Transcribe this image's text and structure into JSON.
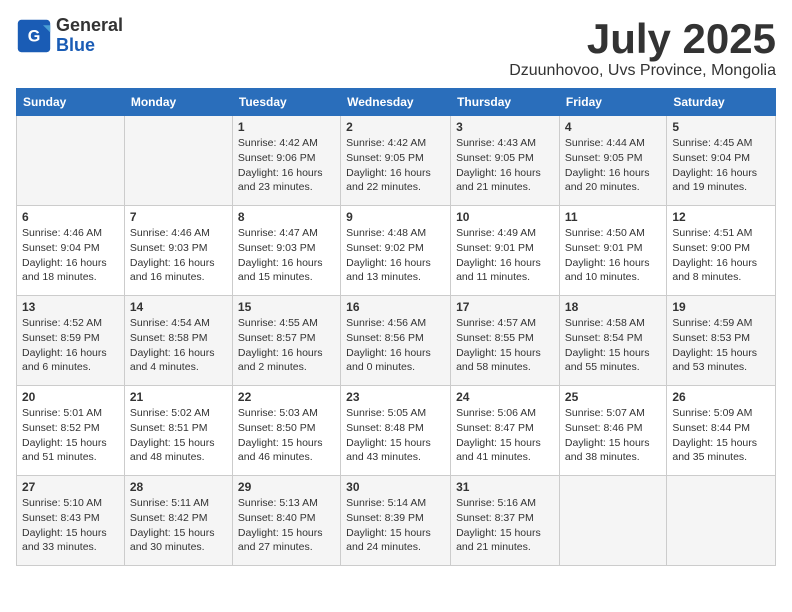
{
  "logo": {
    "general": "General",
    "blue": "Blue"
  },
  "title": "July 2025",
  "location": "Dzuunhovoo, Uvs Province, Mongolia",
  "days_of_week": [
    "Sunday",
    "Monday",
    "Tuesday",
    "Wednesday",
    "Thursday",
    "Friday",
    "Saturday"
  ],
  "weeks": [
    [
      {
        "day": "",
        "info": ""
      },
      {
        "day": "",
        "info": ""
      },
      {
        "day": "1",
        "info": "Sunrise: 4:42 AM\nSunset: 9:06 PM\nDaylight: 16 hours\nand 23 minutes."
      },
      {
        "day": "2",
        "info": "Sunrise: 4:42 AM\nSunset: 9:05 PM\nDaylight: 16 hours\nand 22 minutes."
      },
      {
        "day": "3",
        "info": "Sunrise: 4:43 AM\nSunset: 9:05 PM\nDaylight: 16 hours\nand 21 minutes."
      },
      {
        "day": "4",
        "info": "Sunrise: 4:44 AM\nSunset: 9:05 PM\nDaylight: 16 hours\nand 20 minutes."
      },
      {
        "day": "5",
        "info": "Sunrise: 4:45 AM\nSunset: 9:04 PM\nDaylight: 16 hours\nand 19 minutes."
      }
    ],
    [
      {
        "day": "6",
        "info": "Sunrise: 4:46 AM\nSunset: 9:04 PM\nDaylight: 16 hours\nand 18 minutes."
      },
      {
        "day": "7",
        "info": "Sunrise: 4:46 AM\nSunset: 9:03 PM\nDaylight: 16 hours\nand 16 minutes."
      },
      {
        "day": "8",
        "info": "Sunrise: 4:47 AM\nSunset: 9:03 PM\nDaylight: 16 hours\nand 15 minutes."
      },
      {
        "day": "9",
        "info": "Sunrise: 4:48 AM\nSunset: 9:02 PM\nDaylight: 16 hours\nand 13 minutes."
      },
      {
        "day": "10",
        "info": "Sunrise: 4:49 AM\nSunset: 9:01 PM\nDaylight: 16 hours\nand 11 minutes."
      },
      {
        "day": "11",
        "info": "Sunrise: 4:50 AM\nSunset: 9:01 PM\nDaylight: 16 hours\nand 10 minutes."
      },
      {
        "day": "12",
        "info": "Sunrise: 4:51 AM\nSunset: 9:00 PM\nDaylight: 16 hours\nand 8 minutes."
      }
    ],
    [
      {
        "day": "13",
        "info": "Sunrise: 4:52 AM\nSunset: 8:59 PM\nDaylight: 16 hours\nand 6 minutes."
      },
      {
        "day": "14",
        "info": "Sunrise: 4:54 AM\nSunset: 8:58 PM\nDaylight: 16 hours\nand 4 minutes."
      },
      {
        "day": "15",
        "info": "Sunrise: 4:55 AM\nSunset: 8:57 PM\nDaylight: 16 hours\nand 2 minutes."
      },
      {
        "day": "16",
        "info": "Sunrise: 4:56 AM\nSunset: 8:56 PM\nDaylight: 16 hours\nand 0 minutes."
      },
      {
        "day": "17",
        "info": "Sunrise: 4:57 AM\nSunset: 8:55 PM\nDaylight: 15 hours\nand 58 minutes."
      },
      {
        "day": "18",
        "info": "Sunrise: 4:58 AM\nSunset: 8:54 PM\nDaylight: 15 hours\nand 55 minutes."
      },
      {
        "day": "19",
        "info": "Sunrise: 4:59 AM\nSunset: 8:53 PM\nDaylight: 15 hours\nand 53 minutes."
      }
    ],
    [
      {
        "day": "20",
        "info": "Sunrise: 5:01 AM\nSunset: 8:52 PM\nDaylight: 15 hours\nand 51 minutes."
      },
      {
        "day": "21",
        "info": "Sunrise: 5:02 AM\nSunset: 8:51 PM\nDaylight: 15 hours\nand 48 minutes."
      },
      {
        "day": "22",
        "info": "Sunrise: 5:03 AM\nSunset: 8:50 PM\nDaylight: 15 hours\nand 46 minutes."
      },
      {
        "day": "23",
        "info": "Sunrise: 5:05 AM\nSunset: 8:48 PM\nDaylight: 15 hours\nand 43 minutes."
      },
      {
        "day": "24",
        "info": "Sunrise: 5:06 AM\nSunset: 8:47 PM\nDaylight: 15 hours\nand 41 minutes."
      },
      {
        "day": "25",
        "info": "Sunrise: 5:07 AM\nSunset: 8:46 PM\nDaylight: 15 hours\nand 38 minutes."
      },
      {
        "day": "26",
        "info": "Sunrise: 5:09 AM\nSunset: 8:44 PM\nDaylight: 15 hours\nand 35 minutes."
      }
    ],
    [
      {
        "day": "27",
        "info": "Sunrise: 5:10 AM\nSunset: 8:43 PM\nDaylight: 15 hours\nand 33 minutes."
      },
      {
        "day": "28",
        "info": "Sunrise: 5:11 AM\nSunset: 8:42 PM\nDaylight: 15 hours\nand 30 minutes."
      },
      {
        "day": "29",
        "info": "Sunrise: 5:13 AM\nSunset: 8:40 PM\nDaylight: 15 hours\nand 27 minutes."
      },
      {
        "day": "30",
        "info": "Sunrise: 5:14 AM\nSunset: 8:39 PM\nDaylight: 15 hours\nand 24 minutes."
      },
      {
        "day": "31",
        "info": "Sunrise: 5:16 AM\nSunset: 8:37 PM\nDaylight: 15 hours\nand 21 minutes."
      },
      {
        "day": "",
        "info": ""
      },
      {
        "day": "",
        "info": ""
      }
    ]
  ]
}
